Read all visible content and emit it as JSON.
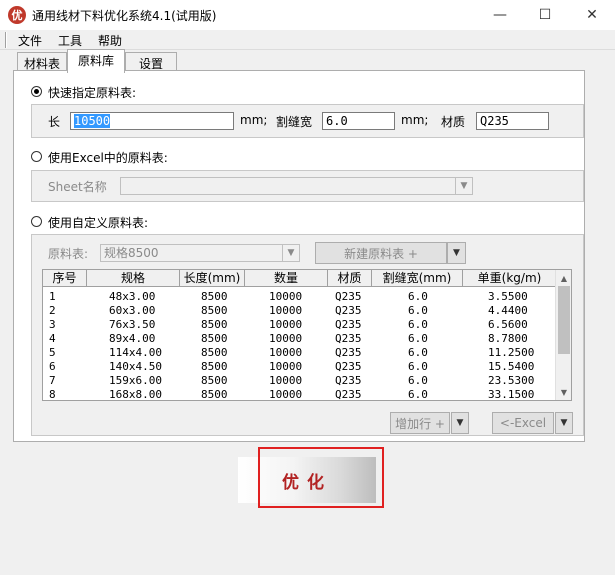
{
  "window": {
    "title": "通用线材下料优化系统4.1(试用版)",
    "icon_char": "优",
    "minimize": "—",
    "maximize": "☐",
    "close": "✕"
  },
  "menu": [
    "文件",
    "工具",
    "帮助"
  ],
  "tabs": [
    "材料表",
    "原料库",
    "设置"
  ],
  "quick": {
    "label": "快速指定原料表:",
    "length_label": "长",
    "length_value": "10500",
    "unit1": "mm;",
    "kerf_label": "割缝宽",
    "kerf_value": "6.0",
    "unit2": "mm;",
    "material_label": "材质",
    "material_value": "Q235"
  },
  "excel": {
    "label": "使用Excel中的原料表:",
    "sheet_label": "Sheet名称"
  },
  "custom": {
    "label": "使用自定义原料表:",
    "table_label": "原料表:",
    "table_value": "规格8500",
    "new_button": "新建原料表 +",
    "add_row_button": "增加行 +",
    "excel_button": "<-Excel"
  },
  "grid": {
    "headers": [
      "序号",
      "规格",
      "长度(mm)",
      "数量",
      "材质",
      "割缝宽(mm)",
      "单重(kg/m)"
    ],
    "rows": [
      [
        "1",
        "48x3.00",
        "8500",
        "10000",
        "Q235",
        "6.0",
        "3.5500"
      ],
      [
        "2",
        "60x3.00",
        "8500",
        "10000",
        "Q235",
        "6.0",
        "4.4400"
      ],
      [
        "3",
        "76x3.50",
        "8500",
        "10000",
        "Q235",
        "6.0",
        "6.5600"
      ],
      [
        "4",
        "89x4.00",
        "8500",
        "10000",
        "Q235",
        "6.0",
        "8.7800"
      ],
      [
        "5",
        "114x4.00",
        "8500",
        "10000",
        "Q235",
        "6.0",
        "11.2500"
      ],
      [
        "6",
        "140x4.50",
        "8500",
        "10000",
        "Q235",
        "6.0",
        "15.5400"
      ],
      [
        "7",
        "159x6.00",
        "8500",
        "10000",
        "Q235",
        "6.0",
        "23.5300"
      ],
      [
        "8",
        "168x8.00",
        "8500",
        "10000",
        "Q235",
        "6.0",
        "33.1500"
      ]
    ]
  },
  "optimize_button": "优化"
}
